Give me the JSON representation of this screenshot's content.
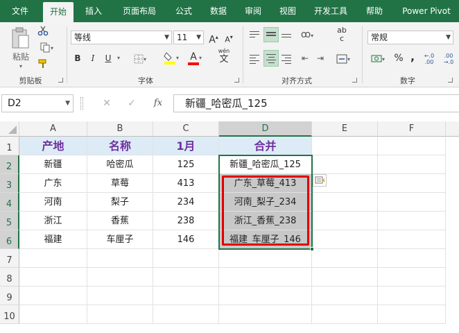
{
  "tabs": [
    "文件",
    "开始",
    "插入",
    "页面布局",
    "公式",
    "数据",
    "审阅",
    "视图",
    "开发工具",
    "帮助",
    "Power Pivot"
  ],
  "ribbon": {
    "clipboard_label": "剪贴板",
    "paste_label": "粘贴",
    "font_label": "字体",
    "align_label": "对齐方式",
    "number_label": "数字",
    "font_name": "等线",
    "font_size": "11",
    "bold": "B",
    "italic": "I",
    "underline": "U",
    "grow_font": "A",
    "shrink_font": "A",
    "font_color": "A",
    "wen": "wén",
    "wen_char": "文",
    "number_format": "常规",
    "percent": "%",
    "comma": ",",
    "dec_inc": "←.0 .00",
    "dec_dec": ".00 →.0",
    "wrap_ab": "ab",
    "wrap_c": "c"
  },
  "formula_bar": {
    "name_box": "D2",
    "fx": "fx",
    "content": "新疆_哈密瓜_125"
  },
  "columns": [
    "A",
    "B",
    "C",
    "D",
    "E",
    "F"
  ],
  "rows": [
    "1",
    "2",
    "3",
    "4",
    "5",
    "6",
    "7",
    "8",
    "9",
    "10"
  ],
  "table": {
    "headers": [
      "产地",
      "名称",
      "1月",
      "合并"
    ],
    "data": [
      [
        "新疆",
        "哈密瓜",
        "125",
        "新疆_哈密瓜_125"
      ],
      [
        "广东",
        "草莓",
        "413",
        "广东_草莓_413"
      ],
      [
        "河南",
        "梨子",
        "234",
        "河南_梨子_234"
      ],
      [
        "浙江",
        "香蕉",
        "238",
        "浙江_香蕉_238"
      ],
      [
        "福建",
        "车厘子",
        "146",
        "福建_车厘子_146"
      ]
    ]
  },
  "colors": {
    "brand": "#217346",
    "header_fill": "#ddebf7",
    "header_text": "#7030a0",
    "highlight": "#e00000"
  },
  "icons": [
    "paste-icon",
    "cut-icon",
    "copy-icon",
    "format-painter-icon",
    "border-icon",
    "fill-color-icon",
    "flash-fill-options-icon",
    "fx-icon",
    "cancel-icon",
    "confirm-icon"
  ]
}
